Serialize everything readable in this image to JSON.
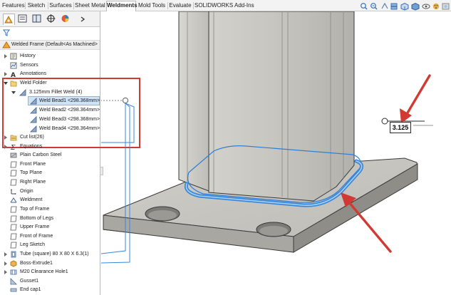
{
  "command_tabs": [
    "Features",
    "Sketch",
    "Surfaces",
    "Sheet Metal",
    "Weldments",
    "Mold Tools",
    "Evaluate",
    "SOLIDWORKS Add-Ins"
  ],
  "active_tab": "Weldments",
  "part_name": "Welded Frame  (Default<As Machined>",
  "tree": {
    "history": "History",
    "sensors": "Sensors",
    "annotations": "Annotations",
    "weld_folder": "Weld Folder",
    "fillet_weld": "3.125mm Fillet Weld (4)",
    "beads": [
      "Weld Bead1 <298.368mm>",
      "Weld Bead2 <298.364mm>",
      "Weld Bead3 <298.368mm>",
      "Weld Bead4 <298.364mm>"
    ],
    "cut_list": "Cut list(26)",
    "equations": "Equations",
    "material": "Plain Carbon Steel",
    "front_plane": "Front Plane",
    "top_plane": "Top Plane",
    "right_plane": "Right Plane",
    "origin": "Origin",
    "weldment": "Weldment",
    "top_of_frame": "Top of Frame",
    "bottom_of_legs": "Bottom of Legs",
    "upper_frame": "Upper Frame",
    "front_of_frame": "Front of Frame",
    "leg_sketch": "Leg Sketch",
    "tube": "Tube (square) 80 X 80 X 6.3(1)",
    "boss_extrude": "Boss-Extrude1",
    "clearance_hole": "M20 Clearance Hole1",
    "gusset": "Gusset1",
    "end_cap": "End cap1"
  },
  "weld_size": "3.125",
  "colors": {
    "accent_red": "#d03a33",
    "weld_blue": "#2f7fd6",
    "selection": "#cfe3f7"
  }
}
